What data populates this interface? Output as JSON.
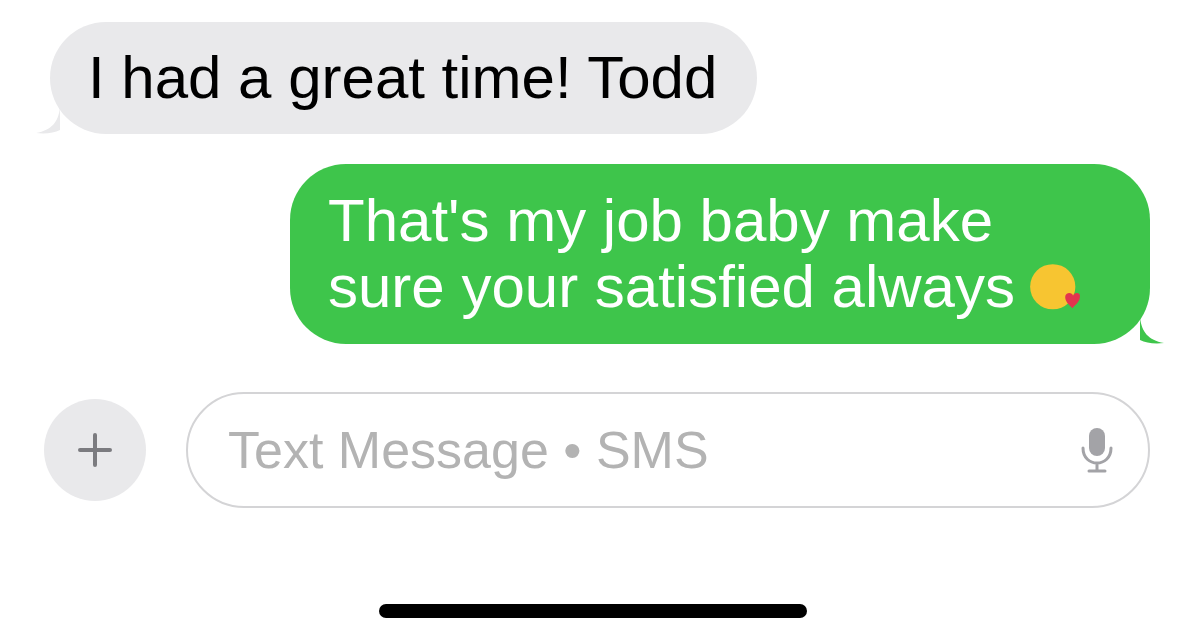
{
  "messages": [
    {
      "kind": "received",
      "text": "I had a great time! Todd",
      "emoji": false
    },
    {
      "kind": "sent",
      "text": "That's my job baby make sure your satisfied always",
      "emoji": true
    }
  ],
  "composer": {
    "placeholder": "Text Message • SMS"
  }
}
